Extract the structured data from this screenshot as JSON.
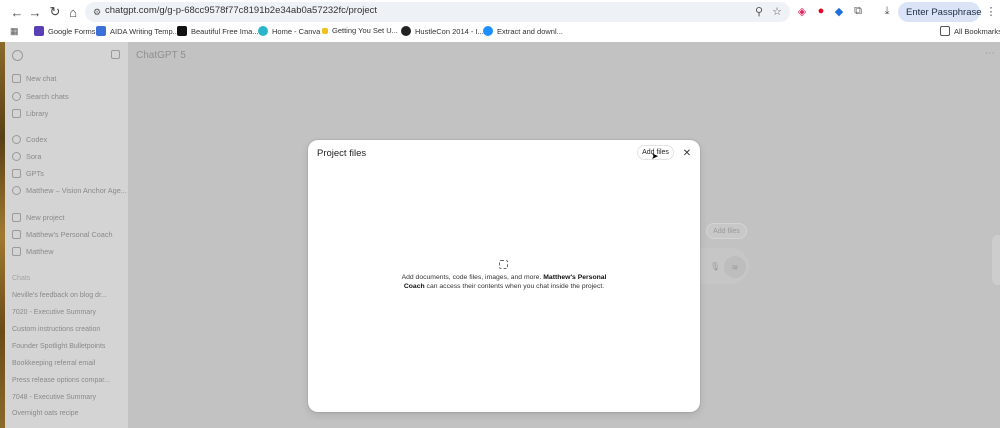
{
  "browser": {
    "url": "chatgpt.com/g/g-p-68cc9578f77c8191b2e34ab0a57232fc/project",
    "profile_label": "Enter Passphrase",
    "bookmarks": [
      {
        "label": "Google Forms",
        "color": "#5b3fb5"
      },
      {
        "label": "AIDA Writing Temp...",
        "color": "#3a6fd8"
      },
      {
        "label": "Beautiful Free Ima...",
        "color": "#111111"
      },
      {
        "label": "Home - Canva",
        "color": "#2bb5c9"
      },
      {
        "label": "Getting You Set U...",
        "color": "#f0c020"
      },
      {
        "label": "HustleCon 2014 - I...",
        "color": "#222222"
      },
      {
        "label": "Extract and downl...",
        "color": "#1e90ff"
      }
    ],
    "all_bookmarks": "All Bookmarks"
  },
  "sidebar": {
    "nav": [
      {
        "label": "New chat",
        "icon": "edit-icon"
      },
      {
        "label": "Search chats",
        "icon": "search-icon"
      },
      {
        "label": "Library",
        "icon": "library-icon"
      },
      {
        "label": "Codex",
        "icon": "codex-icon"
      },
      {
        "label": "Sora",
        "icon": "sora-icon"
      },
      {
        "label": "GPTs",
        "icon": "grid-icon"
      },
      {
        "label": "Matthew – Vision Anchor Age...",
        "icon": "gpt-icon"
      },
      {
        "label": "New project",
        "icon": "folder-icon"
      },
      {
        "label": "Matthew's Personal Coach",
        "icon": "folder-icon"
      },
      {
        "label": "Matthew",
        "icon": "folder-icon"
      }
    ],
    "chats_heading": "Chats",
    "chats": [
      "Neville's feedback on blog dr...",
      "7020 - Executive Summary",
      "Custom instructions creation",
      "Founder Spotlight Bulletpoints",
      "Bookkeeping referral email",
      "Press release options compar...",
      "7048 - Executive Summary",
      "Overnight oats recipe"
    ]
  },
  "main": {
    "model_title": "ChatGPT 5",
    "background_add_files": "Add files"
  },
  "modal": {
    "title": "Project files",
    "add_files_label": "Add files",
    "empty_text_pre": "Add documents, code files, images, and more.",
    "empty_text_bold": "Matthew's Personal Coach",
    "empty_text_post": "can access their contents when you chat inside the project."
  },
  "colors": {
    "overlay": "#c2c2c2",
    "sidebar": "#d4d4d4",
    "modal_bg": "#ffffff",
    "url_bar": "#eef1f6",
    "profile_pill": "#dbe4f7"
  }
}
